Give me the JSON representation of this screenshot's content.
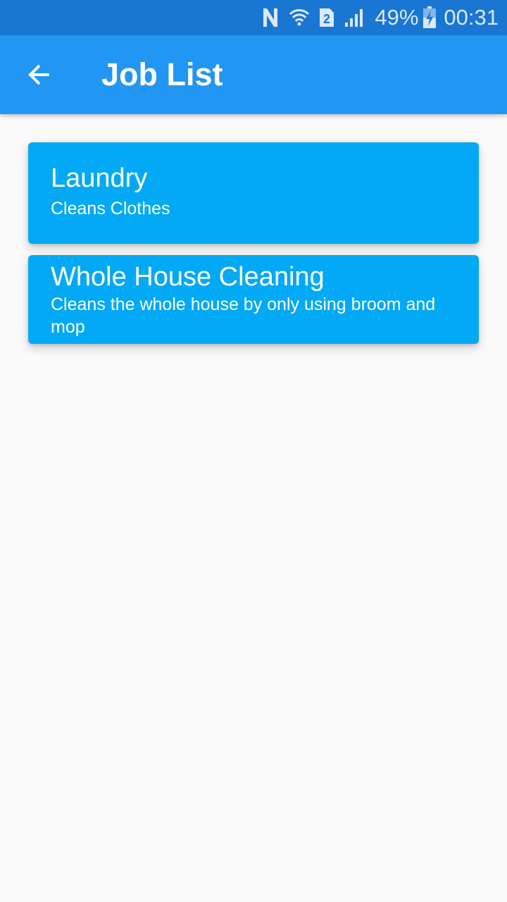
{
  "status_bar": {
    "icons": [
      "nfc-icon",
      "wifi-icon",
      "sim-2-icon",
      "signal-icon",
      "battery-charging-icon"
    ],
    "battery": "49%",
    "time": "00:31"
  },
  "app_bar": {
    "back_icon": "arrow-back-icon",
    "title": "Job List",
    "color": "#2196f3"
  },
  "jobs": [
    {
      "title": "Laundry",
      "description": "Cleans Clothes"
    },
    {
      "title": "Whole House Cleaning",
      "description": "Cleans the whole house by only using broom and mop"
    }
  ],
  "colors": {
    "status_bar": "#1976d2",
    "card": "#03a9f4",
    "background": "#fafafa"
  }
}
